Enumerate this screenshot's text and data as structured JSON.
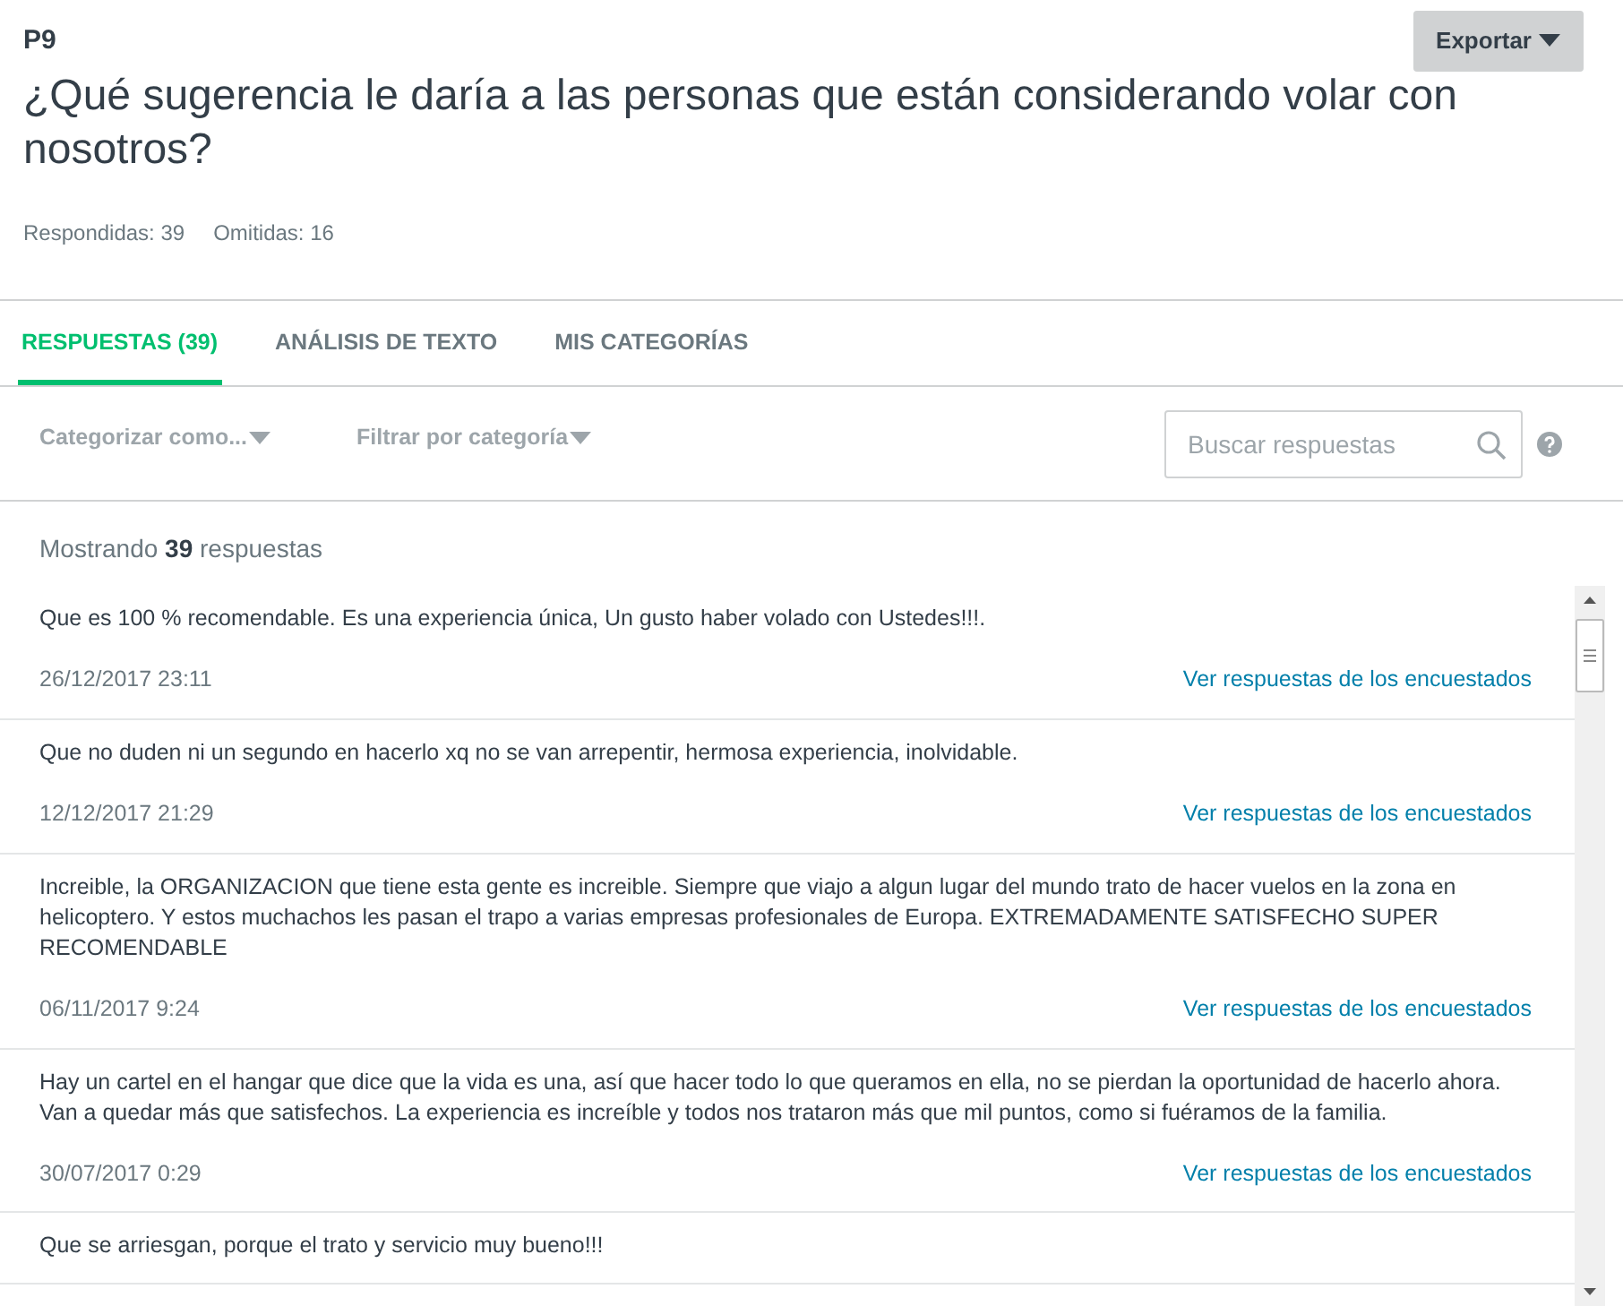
{
  "question": {
    "number": "P9",
    "title": "¿Qué sugerencia le daría a las personas que están considerando volar con nosotros?",
    "stats": [
      "Respondidas: 39",
      "Omitidas: 16"
    ]
  },
  "export_button": {
    "label": "Exportar"
  },
  "tabs": [
    {
      "label": "RESPUESTAS (39)",
      "selected": true
    },
    {
      "label": "ANÁLISIS DE TEXTO",
      "selected": false
    },
    {
      "label": "MIS CATEGORÍAS",
      "selected": false
    }
  ],
  "filters": [
    {
      "label": "Categorizar como..."
    },
    {
      "label": "Filtrar por categoría"
    }
  ],
  "search": {
    "placeholder": "Buscar respuestas"
  },
  "summary": "Mostrando **39** respuestas",
  "responses": [
    {
      "text": "Que es 100 % recomendable. Es una experiencia única, Un gusto haber volado con Ustedes!!!.",
      "date": "26/12/2017 23:11",
      "link": "Ver respuestas de los encuestados"
    },
    {
      "text": "Que no duden ni un segundo en hacerlo xq no se van arrepentir, hermosa experiencia, inolvidable.",
      "date": "12/12/2017 21:29",
      "link": "Ver respuestas de los encuestados"
    },
    {
      "text": "Increible, la ORGANIZACION que tiene esta gente es increible. Siempre que viajo a algun lugar del mundo trato de hacer vuelos en la zona en helicoptero. Y estos muchachos les pasan el trapo a varias empresas profesionales de Europa. EXTREMADAMENTE SATISFECHO SUPER RECOMENDABLE",
      "date": "06/11/2017 9:24",
      "link": "Ver respuestas de los encuestados"
    },
    {
      "text": "Hay un cartel en el hangar que dice que la vida es una, así que hacer todo lo que queramos en ella, no se pierdan la oportunidad de hacerlo ahora. Van a quedar más que satisfechos. La experiencia es increíble y todos nos trataron más que mil puntos, como si fuéramos de la familia.",
      "date": "30/07/2017 0:29",
      "link": "Ver respuestas de los encuestados"
    },
    {
      "text": "Que se arriesgan, porque el trato y servicio muy bueno!!!"
    }
  ]
}
